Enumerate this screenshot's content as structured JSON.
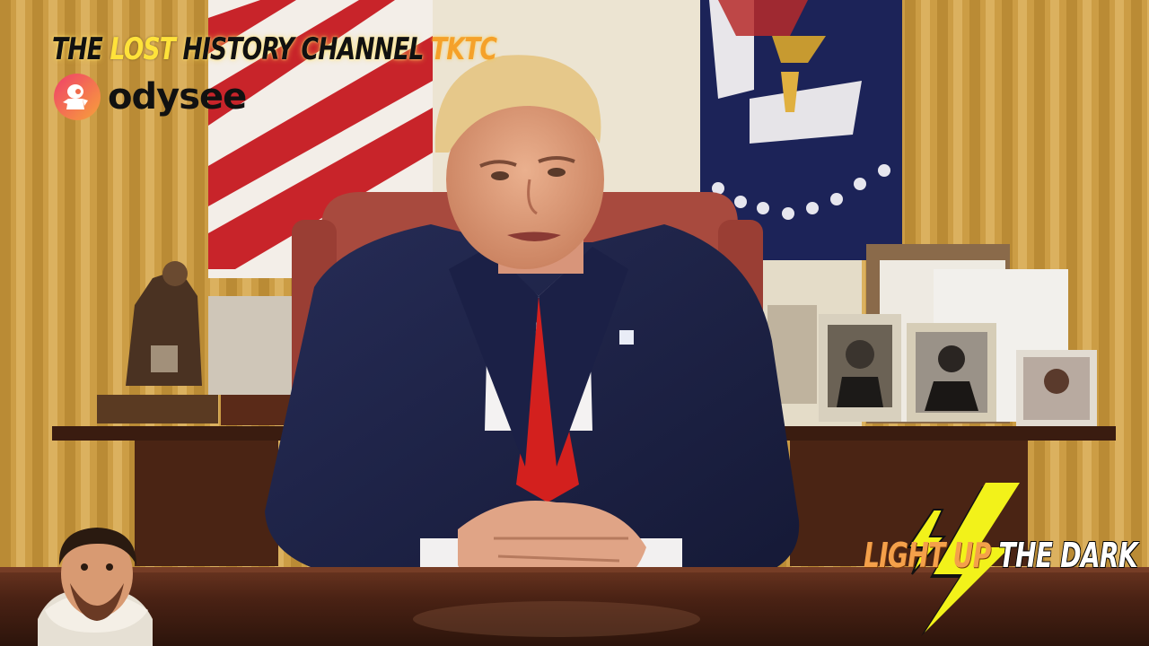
{
  "overlay": {
    "title_part1": "THE ",
    "title_part2": "LOST",
    "title_part3": " HISTORY CHANNEL ",
    "title_part4": "TKTC",
    "brand": "odysee",
    "tagline_part1": "LIGHT UP",
    "tagline_part2": " THE DARK"
  },
  "icons": {
    "brand_logo": "odysee-astronaut-logo-icon",
    "lightning": "lightning-bolt-icon",
    "portrait": "bearded-man-portrait-icon"
  },
  "colors": {
    "title_black": "#111111",
    "title_yellow": "#ffe23a",
    "title_orange": "#f5a12a",
    "tagline_orange": "#f4a04a",
    "bolt_yellow": "#f2f21a",
    "suit_navy": "#1f2448",
    "tie_red": "#d3201e"
  }
}
